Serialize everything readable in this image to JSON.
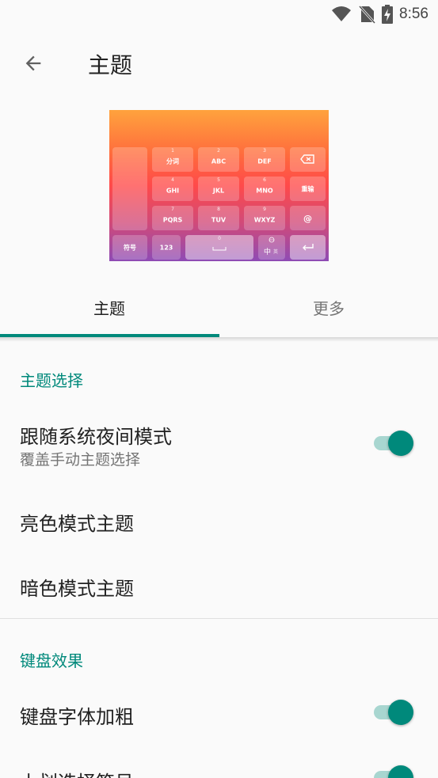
{
  "status_bar": {
    "time": "8:56",
    "icons": [
      "wifi-icon",
      "no-sim-icon",
      "battery-charging-icon"
    ]
  },
  "toolbar": {
    "title": "主题",
    "back_icon": "arrow-back-icon"
  },
  "keyboard_preview": {
    "keys": {
      "symbols": "符号",
      "numbers": "123",
      "row1": [
        {
          "num": "1",
          "label": "分词"
        },
        {
          "num": "2",
          "label": "ABC"
        },
        {
          "num": "3",
          "label": "DEF"
        }
      ],
      "row2": [
        {
          "num": "4",
          "label": "GHI"
        },
        {
          "num": "5",
          "label": "JKL"
        },
        {
          "num": "6",
          "label": "MNO"
        }
      ],
      "row3": [
        {
          "num": "7",
          "label": "PQRS"
        },
        {
          "num": "8",
          "label": "TUV"
        },
        {
          "num": "9",
          "label": "WXYZ"
        }
      ],
      "retype": "重输",
      "at": "@",
      "space_num": "0",
      "lang": "中",
      "lang_sub": "英"
    }
  },
  "tabs": [
    {
      "label": "主题",
      "selected": true
    },
    {
      "label": "更多",
      "selected": false
    }
  ],
  "sections": {
    "theme_select": {
      "header": "主题选择",
      "follow_night": {
        "title": "跟随系统夜间模式",
        "summary": "覆盖手动主题选择",
        "on": true
      },
      "light_theme": {
        "title": "亮色模式主题"
      },
      "dark_theme": {
        "title": "暗色模式主题"
      }
    },
    "keyboard_effect": {
      "header": "键盘效果",
      "bold_font": {
        "title": "键盘字体加粗",
        "on": true
      },
      "swipe_symbol": {
        "title": "上划选择符号",
        "on": true
      }
    }
  },
  "colors": {
    "accent": "#00897b",
    "switch_track": "#a8d6d0"
  }
}
